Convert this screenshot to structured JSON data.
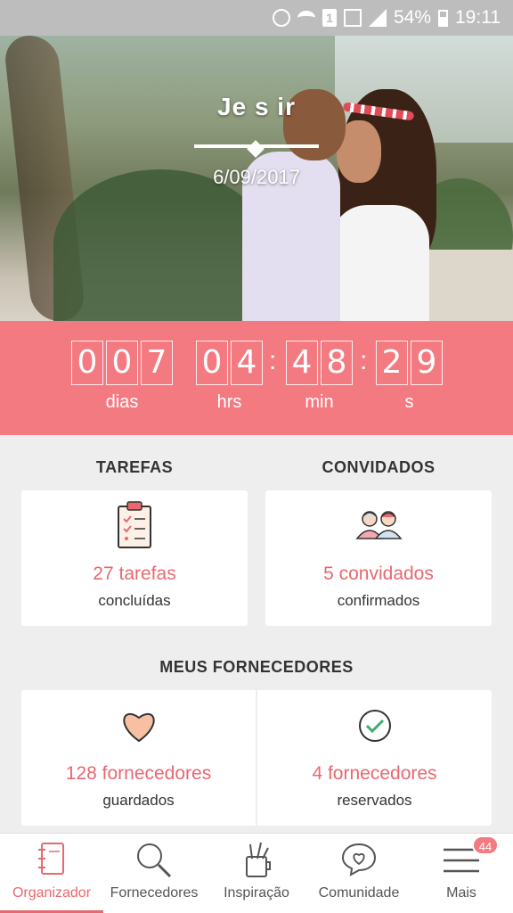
{
  "status_bar": {
    "battery": "54%",
    "time": "19:11",
    "sim_slot": "1"
  },
  "hero": {
    "names": "Je           s         ir",
    "date": "6/09/2017"
  },
  "countdown": {
    "days_digits": [
      "0",
      "0",
      "7"
    ],
    "hours_digits": [
      "0",
      "4"
    ],
    "minutes_digits": [
      "4",
      "8"
    ],
    "seconds_digits": [
      "2",
      "9"
    ],
    "days_label": "dias",
    "hours_label": "hrs",
    "minutes_label": "min",
    "seconds_label": "s"
  },
  "tasks": {
    "title": "TAREFAS",
    "value": "27 tarefas",
    "sub": "concluídas"
  },
  "guests": {
    "title": "CONVIDADOS",
    "value": "5 convidados",
    "sub": "confirmados"
  },
  "vendors": {
    "title": "MEUS FORNECEDORES",
    "saved_value": "128 fornecedores",
    "saved_sub": "guardados",
    "booked_value": "4 fornecedores",
    "booked_sub": "reservados"
  },
  "nav": {
    "items": [
      {
        "label": "Organizador",
        "icon": "notebook-icon"
      },
      {
        "label": "Fornecedores",
        "icon": "search-icon"
      },
      {
        "label": "Inspiração",
        "icon": "pencil-cup-icon"
      },
      {
        "label": "Comunidade",
        "icon": "heart-chat-icon"
      },
      {
        "label": "Mais",
        "icon": "menu-icon"
      }
    ],
    "badge": "44",
    "active_color": "#e9686f"
  },
  "colors": {
    "accent": "#f47a81",
    "accent_text": "#e9686f"
  }
}
